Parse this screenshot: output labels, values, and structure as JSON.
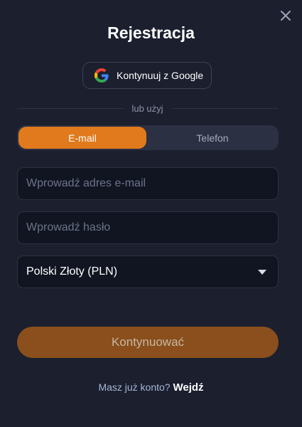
{
  "dialog": {
    "title": "Rejestracja",
    "close_icon": "close-icon"
  },
  "google_button": {
    "label": "Kontynuuj z Google",
    "icon": "google-icon"
  },
  "divider_text": "lub użyj",
  "tabs": [
    {
      "label": "E-mail",
      "active": true
    },
    {
      "label": "Telefon",
      "active": false
    }
  ],
  "email_field": {
    "value": "",
    "placeholder": "Wprowadź adres e-mail"
  },
  "password_field": {
    "value": "",
    "placeholder": "Wprowadź hasło"
  },
  "currency_select": {
    "selected": "Polski Złoty (PLN)",
    "icon": "chevron-down-icon"
  },
  "submit_button": {
    "label": "Kontynuować"
  },
  "footer": {
    "question": "Masz już konto?",
    "login_link": "Wejdź"
  },
  "colors": {
    "background": "#1b1f2e",
    "accent": "#e07a1c",
    "submit_disabled": "#8a4f1c",
    "input_bg": "#111522"
  }
}
